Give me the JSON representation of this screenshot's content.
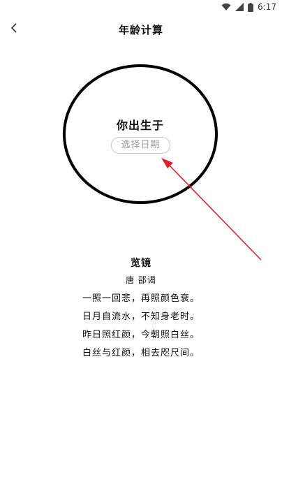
{
  "status_bar": {
    "time": "6:17",
    "icons": [
      "wifi-icon",
      "signal-icon",
      "battery-icon"
    ]
  },
  "header": {
    "title": "年龄计算",
    "back_icon": "chevron-left-icon"
  },
  "birth": {
    "label": "你出生于",
    "date_button": "选择日期"
  },
  "annotation": {
    "arrow_color": "#e0202a"
  },
  "poem": {
    "title": "览镜",
    "author": "唐 邵谒",
    "lines": [
      "一照一回悲，再照颜色衰。",
      "日月自流水，不知身老时。",
      "昨日照红颜，今朝照白丝。",
      "白丝与红颜，相去咫尺间。"
    ]
  }
}
